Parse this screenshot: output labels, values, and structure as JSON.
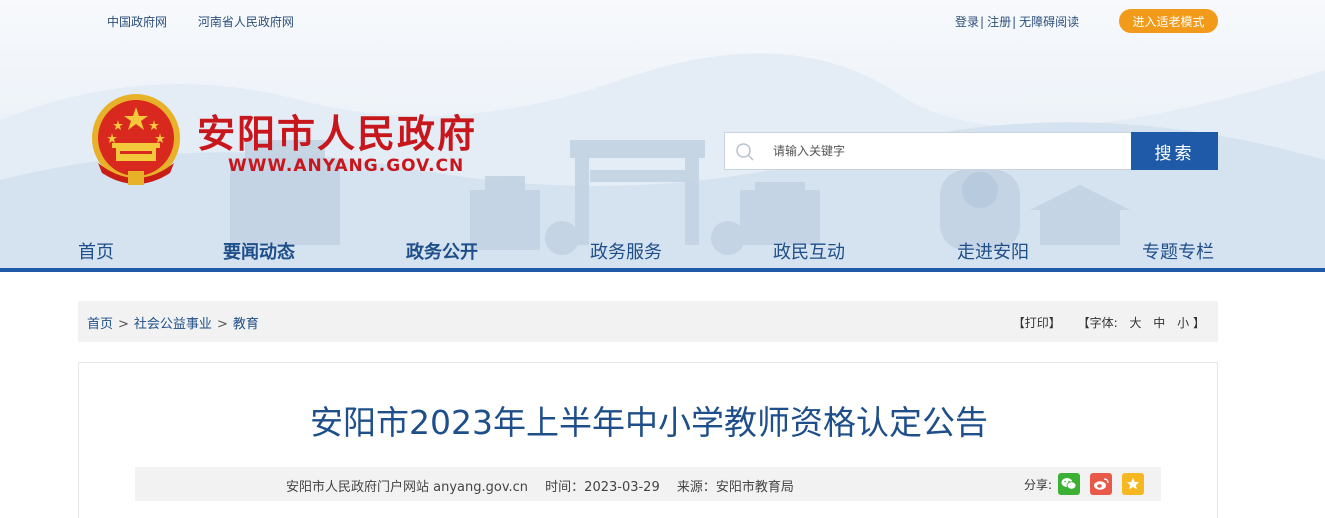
{
  "top_links": [
    "中国政府网",
    "河南省人民政府网"
  ],
  "top_right": {
    "login": "登录",
    "register": "注册",
    "accessible": "无障碍阅读",
    "separator": "|",
    "elder_mode": "进入适老模式"
  },
  "site": {
    "title": "安阳市人民政府",
    "url": "WWW.ANYANG.GOV.CN"
  },
  "search": {
    "placeholder": "请输入关键字",
    "button": "搜索"
  },
  "nav": [
    "首页",
    "要闻动态",
    "政务公开",
    "政务服务",
    "政民互动",
    "走进安阳",
    "专题专栏"
  ],
  "breadcrumb": {
    "items": [
      "首页",
      "社会公益事业",
      "教育"
    ],
    "separator": ">"
  },
  "tools": {
    "print": "【打印】",
    "font_label": "【字体:",
    "large": "大",
    "medium": "中",
    "small": "小",
    "close": "】"
  },
  "article": {
    "title": "安阳市2023年上半年中小学教师资格认定公告",
    "site": "安阳市人民政府门户网站 anyang.gov.cn",
    "time": "时间：2023-03-29",
    "source": "来源：安阳市教育局",
    "share_label": "分享:"
  },
  "colors": {
    "brand_red": "#c8161d",
    "nav_blue": "#1e5aa8",
    "elder_orange": "#f29a1a",
    "wechat": "#3cb034",
    "weibo": "#e8594a",
    "favorite": "#f6b820"
  }
}
